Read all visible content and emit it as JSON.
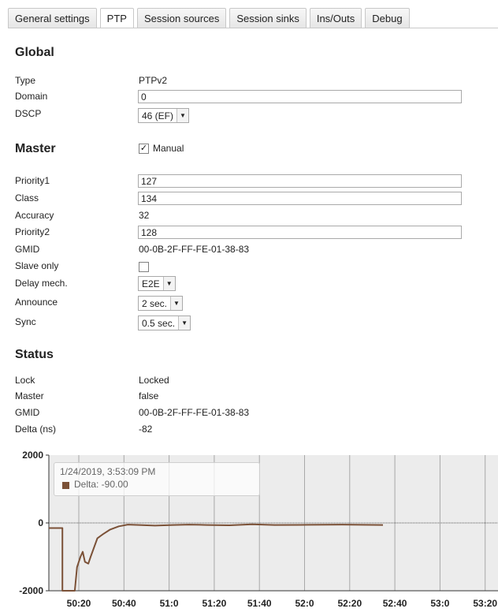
{
  "tabs": [
    {
      "label": "General settings",
      "active": false
    },
    {
      "label": "PTP",
      "active": true
    },
    {
      "label": "Session sources",
      "active": false
    },
    {
      "label": "Session sinks",
      "active": false
    },
    {
      "label": "Ins/Outs",
      "active": false
    },
    {
      "label": "Debug",
      "active": false
    }
  ],
  "global": {
    "heading": "Global",
    "type_label": "Type",
    "type_value": "PTPv2",
    "domain_label": "Domain",
    "domain_value": "0",
    "dscp_label": "DSCP",
    "dscp_value": "46 (EF)"
  },
  "master": {
    "heading": "Master",
    "manual_label": "Manual",
    "manual_checked": true,
    "priority1_label": "Priority1",
    "priority1_value": "127",
    "class_label": "Class",
    "class_value": "134",
    "accuracy_label": "Accuracy",
    "accuracy_value": "32",
    "priority2_label": "Priority2",
    "priority2_value": "128",
    "gmid_label": "GMID",
    "gmid_value": "00-0B-2F-FF-FE-01-38-83",
    "slave_only_label": "Slave only",
    "slave_only_checked": false,
    "delay_label": "Delay mech.",
    "delay_value": "E2E",
    "announce_label": "Announce",
    "announce_value": "2 sec.",
    "sync_label": "Sync",
    "sync_value": "0.5 sec."
  },
  "status": {
    "heading": "Status",
    "lock_label": "Lock",
    "lock_value": "Locked",
    "master_label": "Master",
    "master_value": "false",
    "gmid_label": "GMID",
    "gmid_value": "00-0B-2F-FF-FE-01-38-83",
    "delta_label": "Delta (ns)",
    "delta_value": "-82"
  },
  "tooltip": {
    "date": "1/24/2019, 3:53:09 PM",
    "value": "Delta: -90.00"
  },
  "chart_data": {
    "type": "line",
    "yticks": [
      "2000",
      "0",
      "-2000"
    ],
    "ylim": [
      -2000,
      2000
    ],
    "xticks": [
      "50:20",
      "50:40",
      "51:0",
      "51:20",
      "51:40",
      "52:0",
      "52:20",
      "52:40",
      "53:0",
      "53:20"
    ],
    "series": [
      {
        "name": "Delta",
        "color": "#7b5137",
        "points": [
          [
            0,
            -150
          ],
          [
            6,
            -150
          ],
          [
            6,
            -2000
          ],
          [
            11.5,
            -2000
          ],
          [
            12.5,
            -1300
          ],
          [
            14,
            -1000
          ],
          [
            15,
            -850
          ],
          [
            16,
            -1150
          ],
          [
            17.5,
            -1200
          ],
          [
            18.5,
            -1000
          ],
          [
            21.5,
            -450
          ],
          [
            24,
            -330
          ],
          [
            27,
            -200
          ],
          [
            31,
            -100
          ],
          [
            35,
            -50
          ],
          [
            40,
            -60
          ],
          [
            47,
            -80
          ],
          [
            55,
            -60
          ],
          [
            62,
            -50
          ],
          [
            70,
            -60
          ],
          [
            80,
            -70
          ],
          [
            90,
            -40
          ],
          [
            100,
            -60
          ],
          [
            115,
            -55
          ],
          [
            130,
            -50
          ],
          [
            148,
            -60
          ]
        ]
      }
    ],
    "grid": true
  }
}
